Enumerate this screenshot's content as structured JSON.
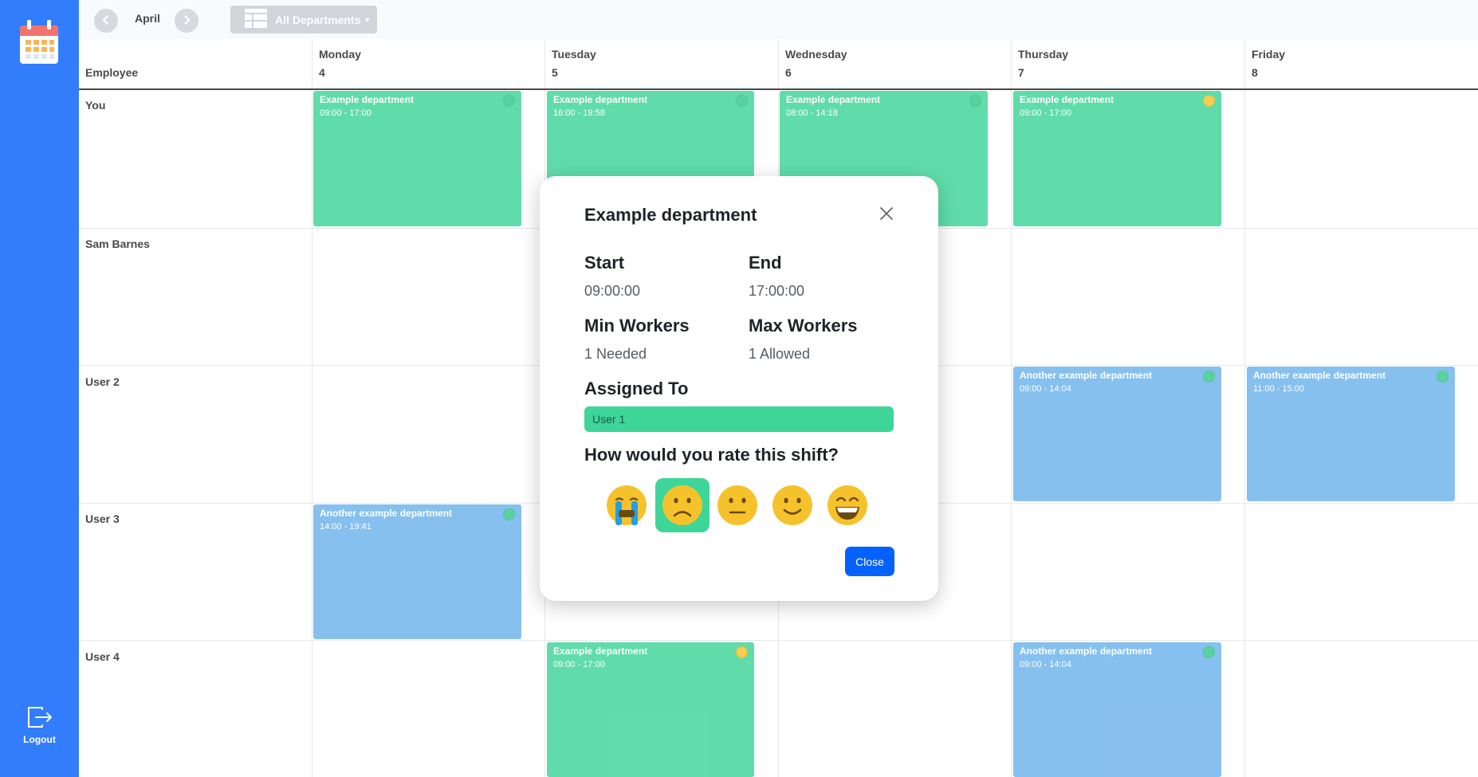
{
  "sidebar": {
    "logo_icon": "calendar-icon",
    "logout_icon": "logout-icon",
    "logout_label": "Logout"
  },
  "toolbar": {
    "month": "April",
    "department_filter": "All Departments"
  },
  "grid": {
    "employee_header": "Employee",
    "days": [
      {
        "name": "Monday",
        "date": "4"
      },
      {
        "name": "Tuesday",
        "date": "5"
      },
      {
        "name": "Wednesday",
        "date": "6"
      },
      {
        "name": "Thursday",
        "date": "7"
      },
      {
        "name": "Friday",
        "date": "8"
      }
    ],
    "employees": [
      "You",
      "Sam Barnes",
      "User 2",
      "User 3",
      "User 4"
    ]
  },
  "shifts": [
    {
      "title": "Example department",
      "time": "09:00 - 17:00"
    },
    {
      "title": "Example department",
      "time": "16:00 - 19:58"
    },
    {
      "title": "Example department",
      "time": "08:00 - 14:18"
    },
    {
      "title": "Example department",
      "time": "09:00 - 17:00"
    },
    {
      "title": "Another example department",
      "time": "09:00 - 14:04"
    },
    {
      "title": "Another example department",
      "time": "11:00 - 15:00"
    },
    {
      "title": "Another example department",
      "time": "14:00 - 19:41"
    },
    {
      "title": "Example department",
      "time": "09:00 - 17:00"
    },
    {
      "title": "Another example department",
      "time": "09:00 - 14:04"
    }
  ],
  "colors": {
    "sidebar": "#0561fc",
    "shift_green": "#3dd598",
    "shift_blue": "#6cb2ec",
    "status_ok": "#35c98c",
    "status_warn": "#f6c22c",
    "primary_button": "#0561fc"
  },
  "modal": {
    "title": "Example department",
    "start_label": "Start",
    "start_value": "09:00:00",
    "end_label": "End",
    "end_value": "17:00:00",
    "min_workers_label": "Min Workers",
    "min_workers_value": "1 Needed",
    "max_workers_label": "Max Workers",
    "max_workers_value": "1 Allowed",
    "assigned_label": "Assigned To",
    "assigned_user": "User 1",
    "rating_question": "How would you rate this shift?",
    "rating_options": [
      "crying-face-icon",
      "frowning-face-icon",
      "neutral-face-icon",
      "smiling-face-icon",
      "grinning-face-icon"
    ],
    "selected_rating": "frowning-face-icon",
    "close_label": "Close"
  }
}
